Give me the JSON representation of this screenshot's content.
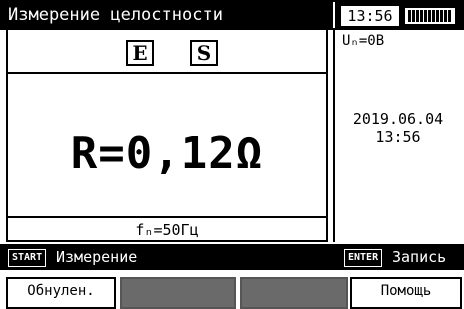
{
  "header": {
    "title": "Измерение целостности",
    "time": "13:56"
  },
  "main": {
    "mode_icon_1": "E",
    "mode_icon_2": "S",
    "reading": "R=0,12Ω",
    "frequency": "fₙ=50Гц"
  },
  "side": {
    "voltage": "Uₙ=0В",
    "date": "2019.06.04",
    "time": "13:56"
  },
  "footer": {
    "start_tag": "START",
    "start_label": "Измерение",
    "enter_tag": "ENTER",
    "enter_label": "Запись"
  },
  "softkeys": {
    "f1": "Обнулен.",
    "f2": "",
    "f3": "",
    "f4": "Помощь"
  },
  "colors": {
    "background": "#ffffff",
    "foreground": "#000000",
    "disabled_key": "#6a6a6a"
  },
  "icons": {
    "battery": "battery-full-icon"
  }
}
